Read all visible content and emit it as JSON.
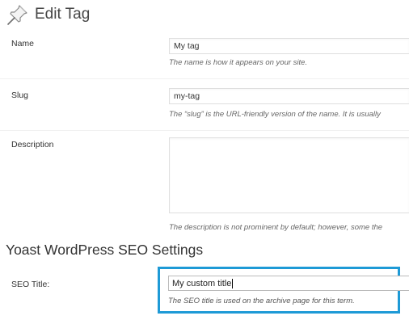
{
  "header": {
    "title": "Edit Tag",
    "icon": "pushpin-icon"
  },
  "fields": {
    "name": {
      "label": "Name",
      "value": "My tag",
      "help": "The name is how it appears on your site."
    },
    "slug": {
      "label": "Slug",
      "value": "my-tag",
      "help": "The “slug” is the URL-friendly version of the name. It is usually"
    },
    "description": {
      "label": "Description",
      "value": "",
      "help": "The description is not prominent by default; however, some the"
    }
  },
  "seo_section": {
    "heading": "Yoast WordPress SEO Settings",
    "seo_title": {
      "label": "SEO Title:",
      "value": "My custom title",
      "help": "The SEO title is used on the archive page for this term."
    },
    "highlight_color": "#1e9ad6"
  }
}
